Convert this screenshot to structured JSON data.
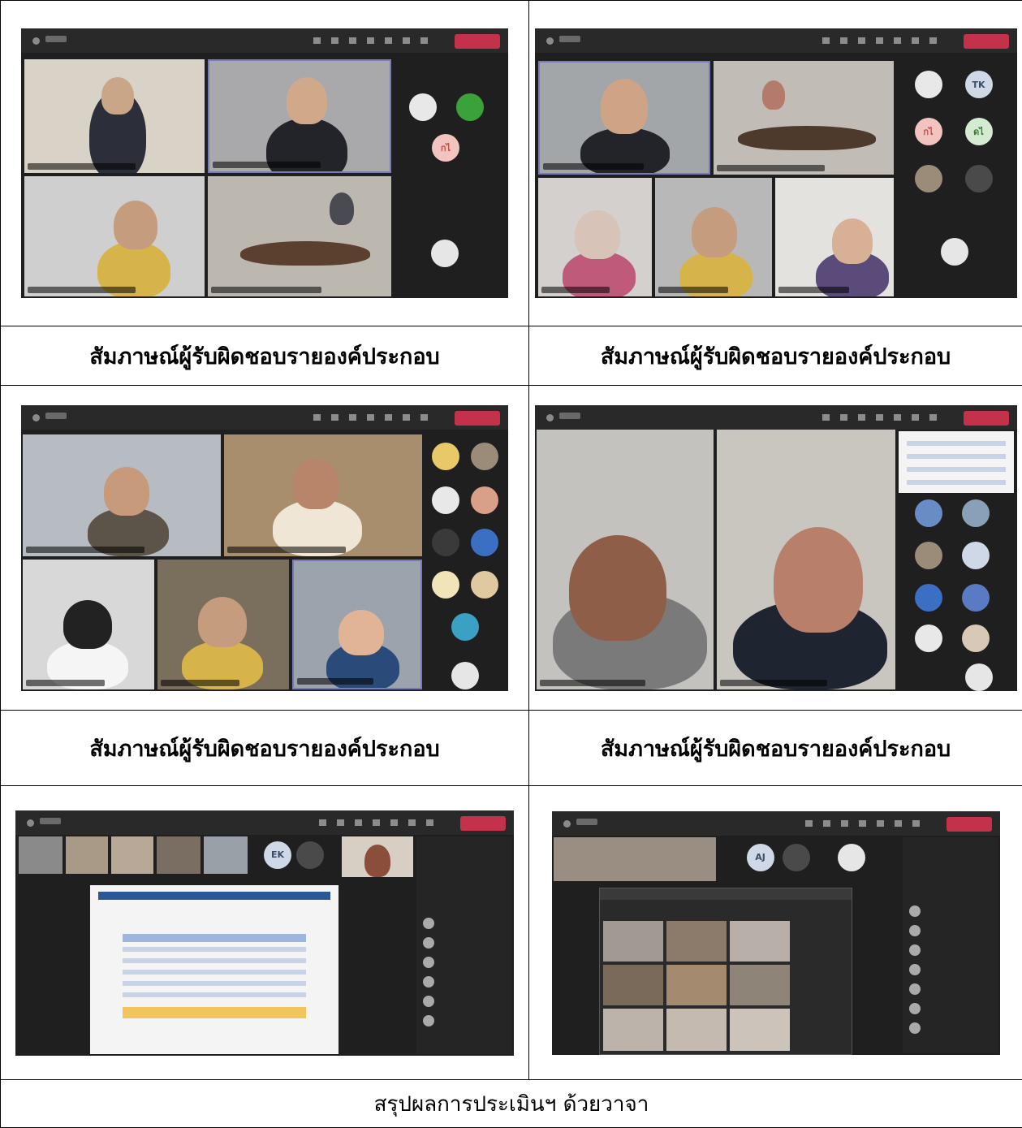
{
  "captions": {
    "row1_left": "สัมภาษณ์ผู้รับผิดชอบรายองค์ประกอบ",
    "row1_right": "สัมภาษณ์ผู้รับผิดชอบรายองค์ประกอบ",
    "row2_left": "สัมภาษณ์ผู้รับผิดชอบรายองค์ประกอบ",
    "row2_right": "สัมภาษณ์ผู้รับผิดชอบรายองค์ประกอบ",
    "row3_full": "สรุปผลการประเมินฯ ด้วยวาจา"
  },
  "avatars": {
    "tk": "TK",
    "kn": "กไ",
    "kn2": "ดไ",
    "ek": "EK",
    "aj": "AJ"
  },
  "colors": {
    "teams_dark": "#1f1f1f",
    "teams_bar": "#292929",
    "leave_red": "#c4314b"
  }
}
